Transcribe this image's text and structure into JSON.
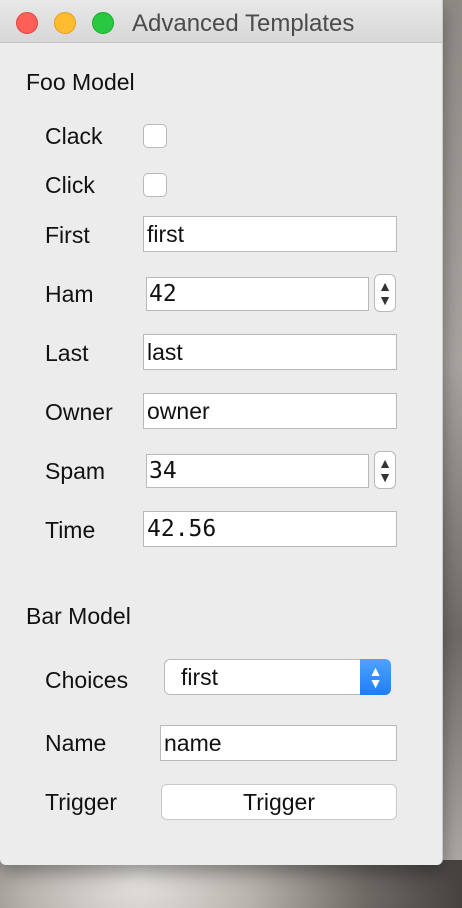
{
  "window": {
    "title": "Advanced Templates"
  },
  "foo_model": {
    "title": "Foo Model",
    "fields": {
      "clack": {
        "label": "Clack",
        "checked": false
      },
      "click": {
        "label": "Click",
        "checked": false
      },
      "first": {
        "label": "First",
        "value": "first"
      },
      "ham": {
        "label": "Ham",
        "value": "42"
      },
      "last": {
        "label": "Last",
        "value": "last"
      },
      "owner": {
        "label": "Owner",
        "value": "owner"
      },
      "spam": {
        "label": "Spam",
        "value": "34"
      },
      "time": {
        "label": "Time",
        "value": "42.56"
      }
    }
  },
  "bar_model": {
    "title": "Bar Model",
    "fields": {
      "choices": {
        "label": "Choices",
        "selected": "first"
      },
      "name": {
        "label": "Name",
        "value": "name"
      },
      "trigger": {
        "label": "Trigger",
        "button_label": "Trigger"
      }
    }
  },
  "icons": {
    "stepper_up": "▲",
    "stepper_down": "▼",
    "select_up": "▲",
    "select_down": "▼"
  },
  "colors": {
    "close": "#fe5f57",
    "minimize": "#febc2e",
    "maximize": "#28c840",
    "select_accent": "#1e7ef8"
  }
}
